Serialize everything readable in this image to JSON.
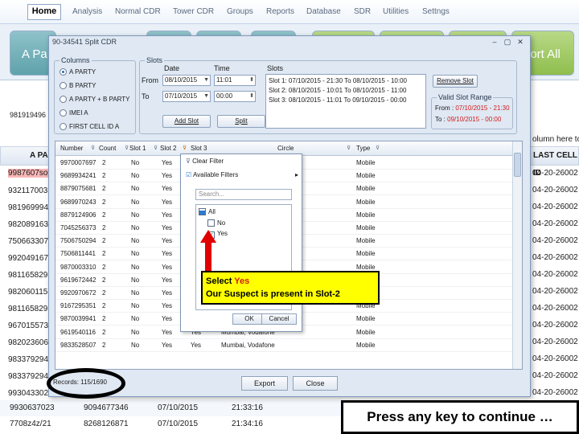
{
  "menu": {
    "home": "Home",
    "items": [
      "Analysis",
      "Normal CDR",
      "Tower CDR",
      "Groups",
      "Reports",
      "Database",
      "SDR",
      "Utilities",
      "Settngs"
    ]
  },
  "ribbon": {
    "left_label": "A Pa",
    "right_label": "port All"
  },
  "background": {
    "left_header": "A PA",
    "phone_label": "981919496",
    "left_rows": [
      "9987607so",
      "932117003",
      "981969994",
      "982089163",
      "750663307",
      "992049167",
      "981165829",
      "982060115",
      "981165829",
      "967015573",
      "982023606",
      "983379294",
      "983379294",
      "993043302"
    ],
    "right_header": "LAST CELL ID",
    "right_hint": "olumn here to",
    "right_rows": [
      "04-20-26002",
      "04-20-26002",
      "04-20-26002",
      "04-20-26002",
      "04-20-26002",
      "04-20-26002",
      "04-20-26002",
      "04-20-26002",
      "04-20-26002",
      "04-20-26002",
      "04-20-26002",
      "04-20-26002",
      "04-20-26002",
      "04-20-26002",
      "04-20-26002",
      "04-20-26002"
    ],
    "bottom_rows": [
      [
        "9930637023",
        "9094677346",
        "07/10/2015",
        "21:33:16"
      ],
      [
        "7708z4z/21",
        "8268126871",
        "07/10/2015",
        "21:34:16"
      ]
    ]
  },
  "dialog": {
    "title": "90-34541 Split CDR",
    "columns": {
      "label": "Columns",
      "options": [
        "A PARTY",
        "B PARTY",
        "A PARTY + B PARTY",
        "IMEI A",
        "FIRST CELL ID A"
      ]
    },
    "slots": {
      "label": "Slots",
      "date_label": "Date",
      "time_label": "Time",
      "slots_label": "Slots",
      "from_label": "From",
      "to_label": "To",
      "from_date": "08/10/2015",
      "from_time": "11:01",
      "to_date": "07/10/2015",
      "to_time": "00:00",
      "add_slot": "Add Slot",
      "split": "Split",
      "remove_slot": "Remove Slot",
      "slot_list": [
        "Slot 1: 07/10/2015 - 21:30 To 08/10/2015 - 10:00",
        "Slot 2: 08/10/2015 - 10:01 To 08/10/2015 - 11:00",
        "Slot 3: 08/10/2015 - 11:01 To 09/10/2015 - 00:00"
      ],
      "valid_range_label": "Valid Slot Range",
      "valid_from_label": "From :",
      "valid_from": "07/10/2015 - 21:30",
      "valid_to_label": "To   :",
      "valid_to": "09/10/2015 - 00:00"
    },
    "grid": {
      "headers": [
        "Number",
        "Count",
        "Slot 1",
        "Slot 2",
        "Slot 3",
        "Circle",
        "Type"
      ],
      "rows": [
        [
          "9970007697",
          "2",
          "No",
          "Yes",
          "",
          "",
          "Mobile"
        ],
        [
          "9689934241",
          "2",
          "No",
          "Yes",
          "",
          "",
          "Mobile"
        ],
        [
          "8879075681",
          "2",
          "No",
          "Yes",
          "",
          "",
          "Mobile"
        ],
        [
          "9689970243",
          "2",
          "No",
          "Yes",
          "",
          "",
          "Mobile"
        ],
        [
          "8879124906",
          "2",
          "No",
          "Yes",
          "",
          "",
          "Mobile"
        ],
        [
          "7045256373",
          "2",
          "No",
          "Yes",
          "",
          "",
          "Mobile"
        ],
        [
          "7506750294",
          "2",
          "No",
          "Yes",
          "",
          "",
          "Mobile"
        ],
        [
          "7506811441",
          "2",
          "No",
          "Yes",
          "",
          "",
          "Mobile"
        ],
        [
          "9870003310",
          "2",
          "No",
          "Yes",
          "",
          "",
          "Mobile"
        ],
        [
          "9619672442",
          "2",
          "No",
          "Yes",
          "",
          "",
          "Mobile"
        ],
        [
          "9920970672",
          "2",
          "No",
          "Yes",
          "",
          "",
          "Mobile"
        ],
        [
          "9167295351",
          "2",
          "No",
          "Yes",
          "",
          "",
          "Mobile"
        ],
        [
          "9870039941",
          "2",
          "No",
          "Yes",
          "",
          "",
          "Mobile"
        ],
        [
          "9619540116",
          "2",
          "No",
          "Yes",
          "Yes",
          "Mumbai, Vodafone",
          "Mobile"
        ],
        [
          "9833528507",
          "2",
          "No",
          "Yes",
          "Yes",
          "Mumbai, Vodafone",
          "Mobile"
        ]
      ]
    },
    "filter_popup": {
      "clear": "Clear Filter",
      "available": "Available Filters",
      "search_placeholder": "Search...",
      "tree": [
        "All",
        "No",
        "Yes"
      ],
      "ok": "OK",
      "cancel": "Cancel"
    },
    "records": "Records: 115/1690",
    "export": "Export",
    "close": "Close"
  },
  "annotation": {
    "line1_prefix": "Select ",
    "line1_highlight": "Yes",
    "line2": "Our Suspect is present in Slot-2"
  },
  "continue_text": "Press any key to continue …"
}
